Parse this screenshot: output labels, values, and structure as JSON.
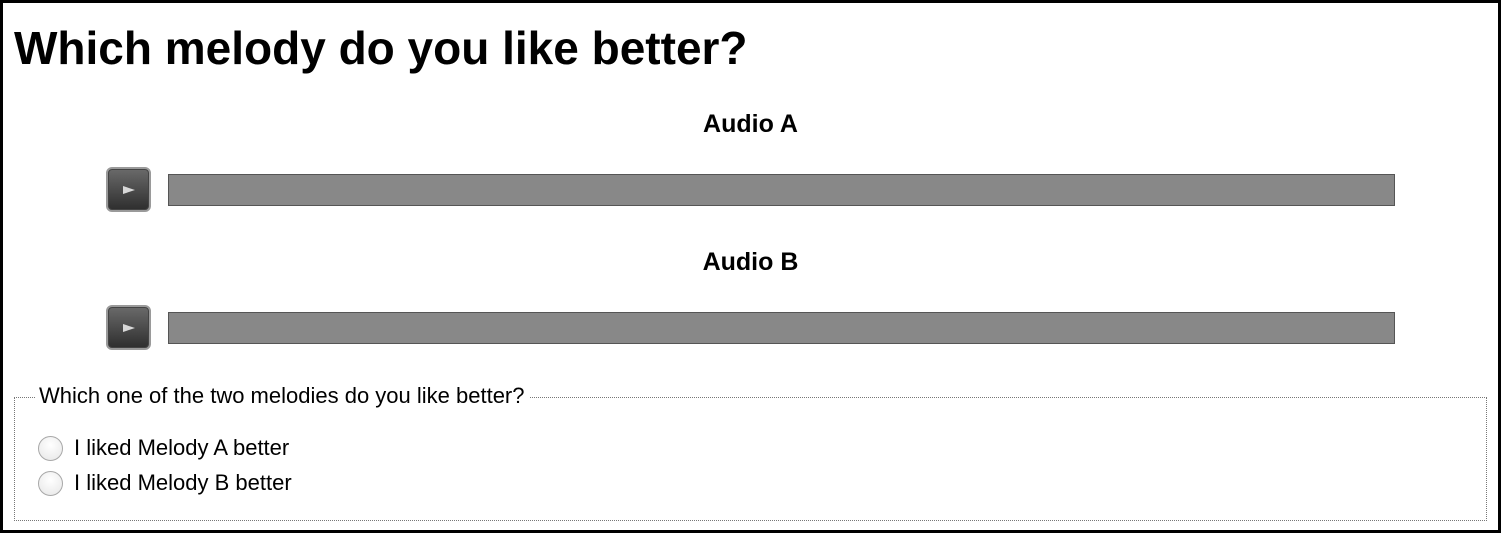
{
  "page": {
    "title": "Which melody do you like better?"
  },
  "audio": [
    {
      "title": "Audio A",
      "play_icon": "play-icon",
      "progress": 0
    },
    {
      "title": "Audio B",
      "play_icon": "play-icon",
      "progress": 0
    }
  ],
  "question": {
    "legend": "Which one of the two melodies do you like better?",
    "options": [
      {
        "label": "I liked Melody A better",
        "selected": false
      },
      {
        "label": "I liked Melody B better",
        "selected": false
      }
    ]
  },
  "colors": {
    "track": "#888888",
    "play_button": "#3a3a3a"
  }
}
